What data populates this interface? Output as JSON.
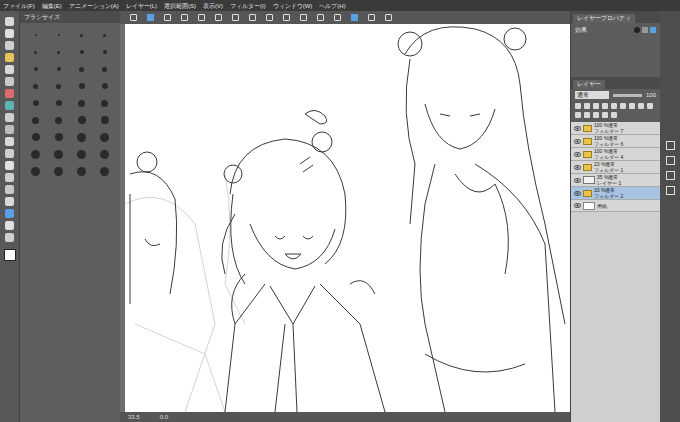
{
  "menu": [
    "ファイル(F)",
    "編集(E)",
    "アニメーション(A)",
    "レイヤー(L)",
    "選択範囲(S)",
    "表示(V)",
    "フィルター(I)",
    "ウィンドウ(W)",
    "ヘルプ(H)"
  ],
  "subtool": {
    "title": "ブラシサイズ"
  },
  "properties": {
    "tab": "レイヤープロパティ",
    "effect_label": "効果"
  },
  "layer_panel": {
    "tab": "レイヤー",
    "blend_mode": "通常",
    "opacity": "100"
  },
  "layers": [
    {
      "mode": "100 %通常",
      "name": "フォルダー 7",
      "kind": "folder",
      "visible": true,
      "selected": false
    },
    {
      "mode": "100 %通常",
      "name": "フォルダー 6",
      "kind": "folder",
      "visible": true,
      "selected": false
    },
    {
      "mode": "100 %通常",
      "name": "フォルダー 4",
      "kind": "folder",
      "visible": true,
      "selected": false
    },
    {
      "mode": "23 %通常",
      "name": "フォルダー 1",
      "kind": "folder",
      "visible": true,
      "selected": false
    },
    {
      "mode": "35 %通常",
      "name": "レイヤー 1",
      "kind": "raster",
      "visible": true,
      "selected": false
    },
    {
      "mode": "33 %通常",
      "name": "フォルダー 2",
      "kind": "folder",
      "visible": true,
      "selected": true
    },
    {
      "mode": "",
      "name": "用紙",
      "kind": "paper",
      "visible": true,
      "selected": false
    }
  ],
  "status": {
    "zoom": "33.5",
    "angle": "0.0"
  }
}
